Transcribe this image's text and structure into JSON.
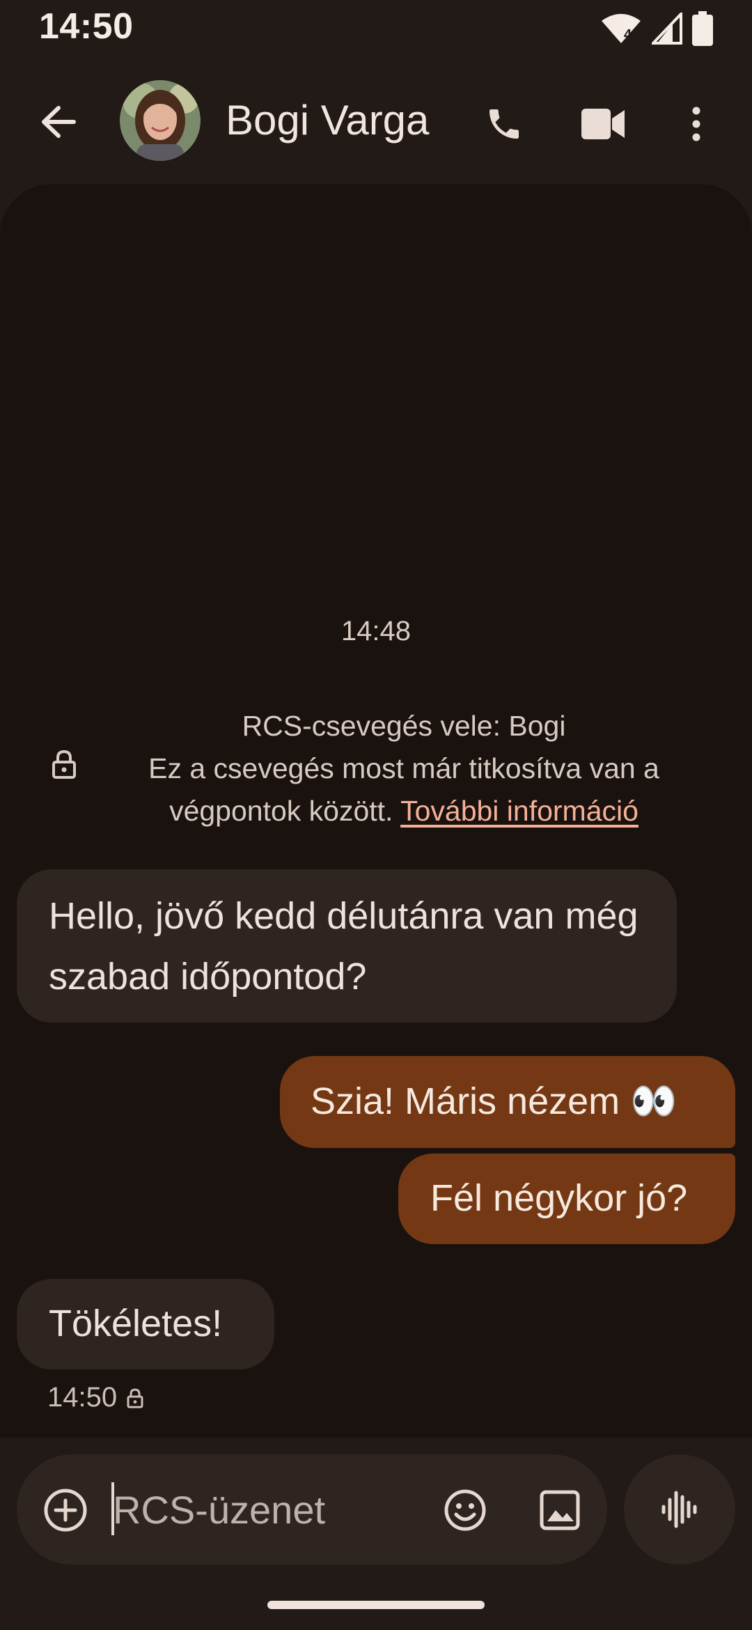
{
  "status_bar": {
    "time": "14:50",
    "network_label": "4"
  },
  "header": {
    "contact_name": "Bogi Varga"
  },
  "conversation": {
    "timestamp": "14:48",
    "encryption_notice": {
      "line1": "RCS-csevegés vele: Bogi",
      "line2": "Ez a csevegés most már titkosítva van a",
      "line3": "végpontok között.",
      "link": "További információ"
    },
    "messages": [
      {
        "direction": "incoming",
        "text": "Hello, jövő kedd délutánra van még szabad időpontod?"
      },
      {
        "direction": "outgoing",
        "text": "Szia! Máris nézem 👀"
      },
      {
        "direction": "outgoing",
        "text": "Fél négykor jó?"
      },
      {
        "direction": "incoming",
        "text": "Tökéletes!"
      }
    ],
    "last_message_time": "14:50"
  },
  "composer": {
    "placeholder": "RCS-üzenet"
  },
  "colors": {
    "background": "#211a16",
    "conversation_bg": "#1a120e",
    "incoming_bubble": "#2e2521",
    "outgoing_bubble": "#743914",
    "link": "#f5b198"
  }
}
